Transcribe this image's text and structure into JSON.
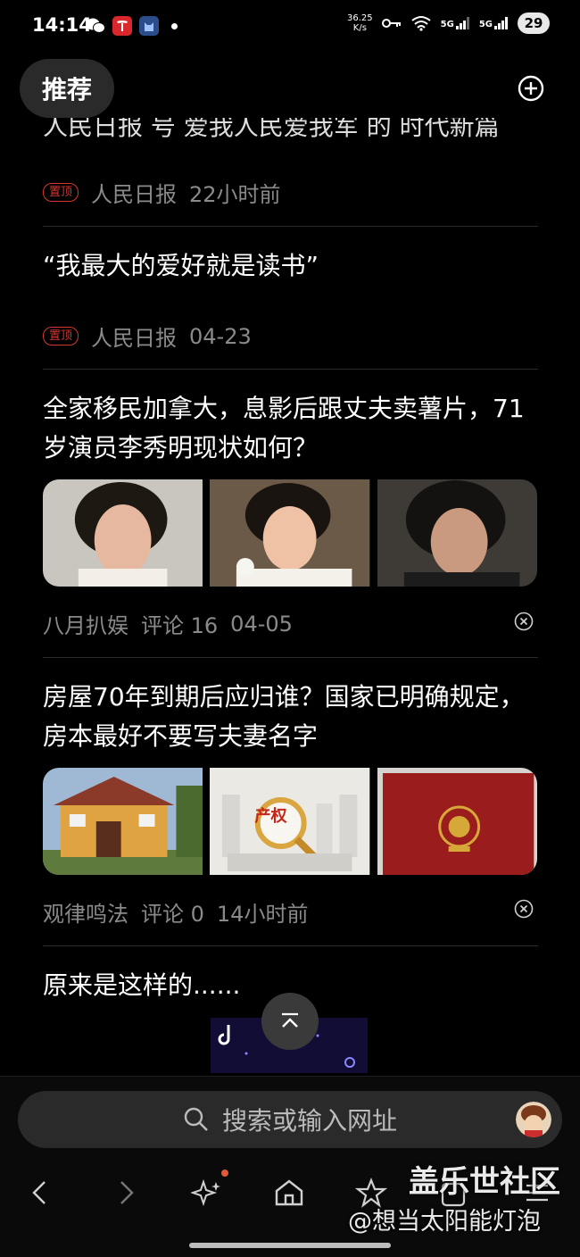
{
  "status_bar": {
    "time": "14:14",
    "net_speed_value": "36.25",
    "net_speed_unit": "K/s",
    "sig1": "5G",
    "sig2": "5G",
    "battery": "29"
  },
  "header": {
    "tab_label": "推荐",
    "add_icon": "plus-circle-icon"
  },
  "feed": {
    "clipped_title": "人民日报 号 爱我人民爱我军 的 时代新篇",
    "items": [
      {
        "badge": "置顶",
        "source": "人民日报",
        "time": "22小时前"
      },
      {
        "title": "“我最大的爱好就是读书”",
        "badge": "置顶",
        "source": "人民日报",
        "time": "04-23"
      },
      {
        "title": "全家移民加拿大，息影后跟丈夫卖薯片，71岁演员李秀明现状如何？",
        "source": "八月扒娱",
        "comments": "评论 16",
        "time": "04-05"
      },
      {
        "title": "房屋70年到期后应归谁？国家已明确规定，房本最好不要写夫妻名字",
        "source": "观律鸣法",
        "comments": "评论 0",
        "time": "14小时前",
        "img_text": "产权"
      },
      {
        "title": "原来是这样的......"
      }
    ]
  },
  "search": {
    "placeholder": "搜索或输入网址"
  },
  "watermark": {
    "line1": "盖乐世社区",
    "line2": "@想当太阳能灯泡"
  },
  "colors": {
    "badge_red": "#d3362f",
    "meta_gray": "#8a8a8a",
    "background": "#000000"
  }
}
